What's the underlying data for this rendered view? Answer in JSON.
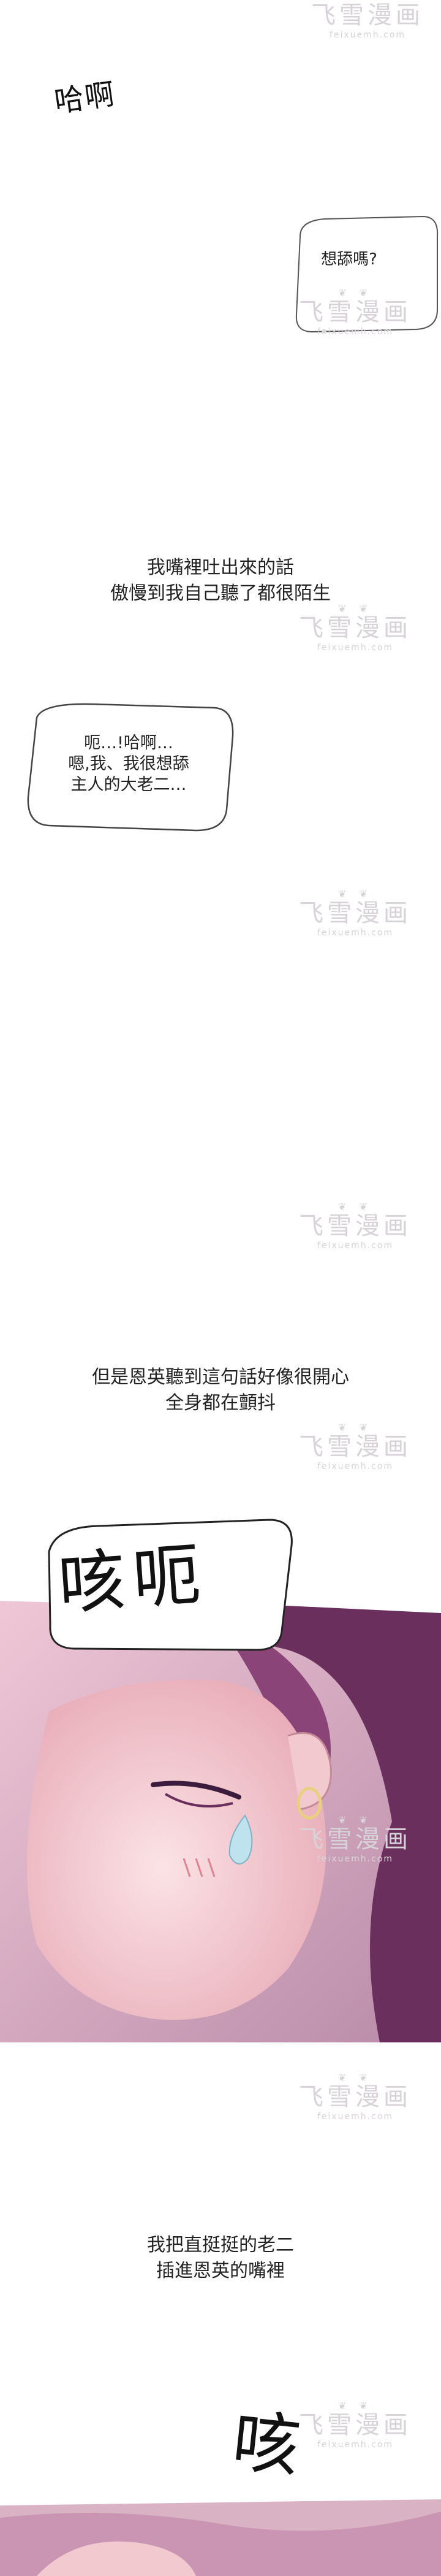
{
  "sfx_top": "哈啊",
  "bubble_1": "想舔嗎?",
  "caption_1": {
    "line1": "我嘴裡吐出來的話",
    "line2": "傲慢到我自己聽了都很陌生"
  },
  "bubble_2": {
    "line1": "呃…!哈啊…",
    "line2": "嗯,我、我很想舔",
    "line3": "主人的大老二…"
  },
  "caption_2": {
    "line1": "但是恩英聽到這句話好像很開心",
    "line2": "全身都在顫抖"
  },
  "sfx_cough": "咳呃",
  "caption_3": {
    "line1": "我把直挺挺的老二",
    "line2": "插進恩英的嘴裡"
  },
  "sfx_bottom": "咳",
  "watermark": {
    "cn": "飞雪漫画",
    "en": "feixuemh.com"
  },
  "colors": {
    "skin": "#f2c9cf",
    "hair": "#6b2f5e",
    "panel_bg": "#d9b3c4"
  }
}
